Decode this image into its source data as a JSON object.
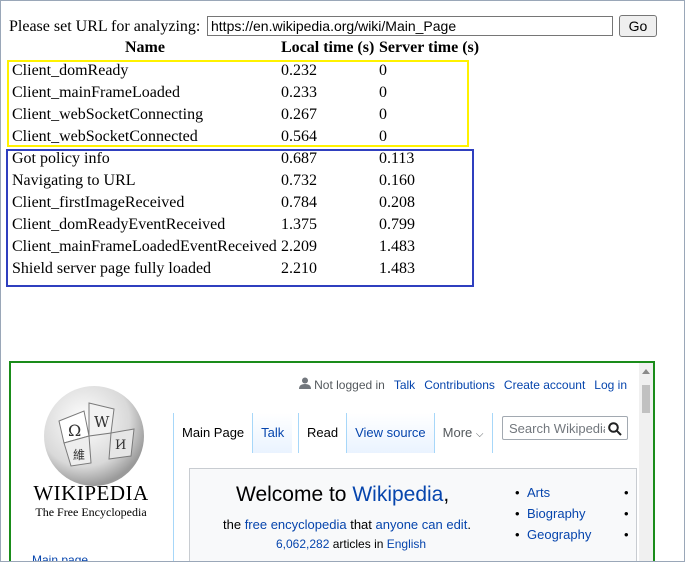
{
  "url_bar": {
    "label": "Please set URL for analyzing:",
    "value": "https://en.wikipedia.org/wiki/Main_Page",
    "go_label": "Go"
  },
  "table": {
    "headers": {
      "name": "Name",
      "local": "Local time (s)",
      "server": "Server time (s)"
    },
    "client_rows": [
      {
        "name": "Client_domReady",
        "local": "0.232",
        "server": "0"
      },
      {
        "name": "Client_mainFrameLoaded",
        "local": "0.233",
        "server": "0"
      },
      {
        "name": "Client_webSocketConnecting",
        "local": "0.267",
        "server": "0"
      },
      {
        "name": "Client_webSocketConnected",
        "local": "0.564",
        "server": "0"
      }
    ],
    "server_rows": [
      {
        "name": "Got policy info",
        "local": "0.687",
        "server": "0.113"
      },
      {
        "name": "Navigating to URL",
        "local": "0.732",
        "server": "0.160"
      },
      {
        "name": "Client_firstImageReceived",
        "local": "0.784",
        "server": "0.208"
      },
      {
        "name": "Client_domReadyEventReceived",
        "local": "1.375",
        "server": "0.799"
      },
      {
        "name": "Client_mainFrameLoadedEventReceived",
        "local": "2.209",
        "server": "1.483"
      },
      {
        "name": "Shield server page fully loaded",
        "local": "2.210",
        "server": "1.483"
      }
    ],
    "colors": {
      "client_box": "#fff200",
      "server_box": "#2f3fbf"
    }
  },
  "preview": {
    "border_color": "#1a8c1a",
    "logo": {
      "wordmark": "WIKIPEDIA",
      "tagline": "The Free Encyclopedia"
    },
    "sidebar_link": "Main page",
    "user_nav": {
      "status": "Not logged in",
      "talk": "Talk",
      "contributions": "Contributions",
      "create_account": "Create account",
      "login": "Log in"
    },
    "tabs_left": {
      "main_page": "Main Page",
      "talk": "Talk"
    },
    "tabs_right": {
      "read": "Read",
      "view_source": "View source",
      "more": "More"
    },
    "search_placeholder": "Search Wikipedia",
    "welcome": {
      "title_prefix": "Welcome to ",
      "title_link": "Wikipedia",
      "title_suffix": ",",
      "sub_the": "the ",
      "sub_link1": "free encyclopedia",
      "sub_that": " that ",
      "sub_link2": "anyone can edit",
      "sub_end": ".",
      "count": "6,062,282",
      "count_mid": " articles in ",
      "language": "English"
    },
    "portals": [
      "Arts",
      "Biography",
      "Geography"
    ]
  }
}
